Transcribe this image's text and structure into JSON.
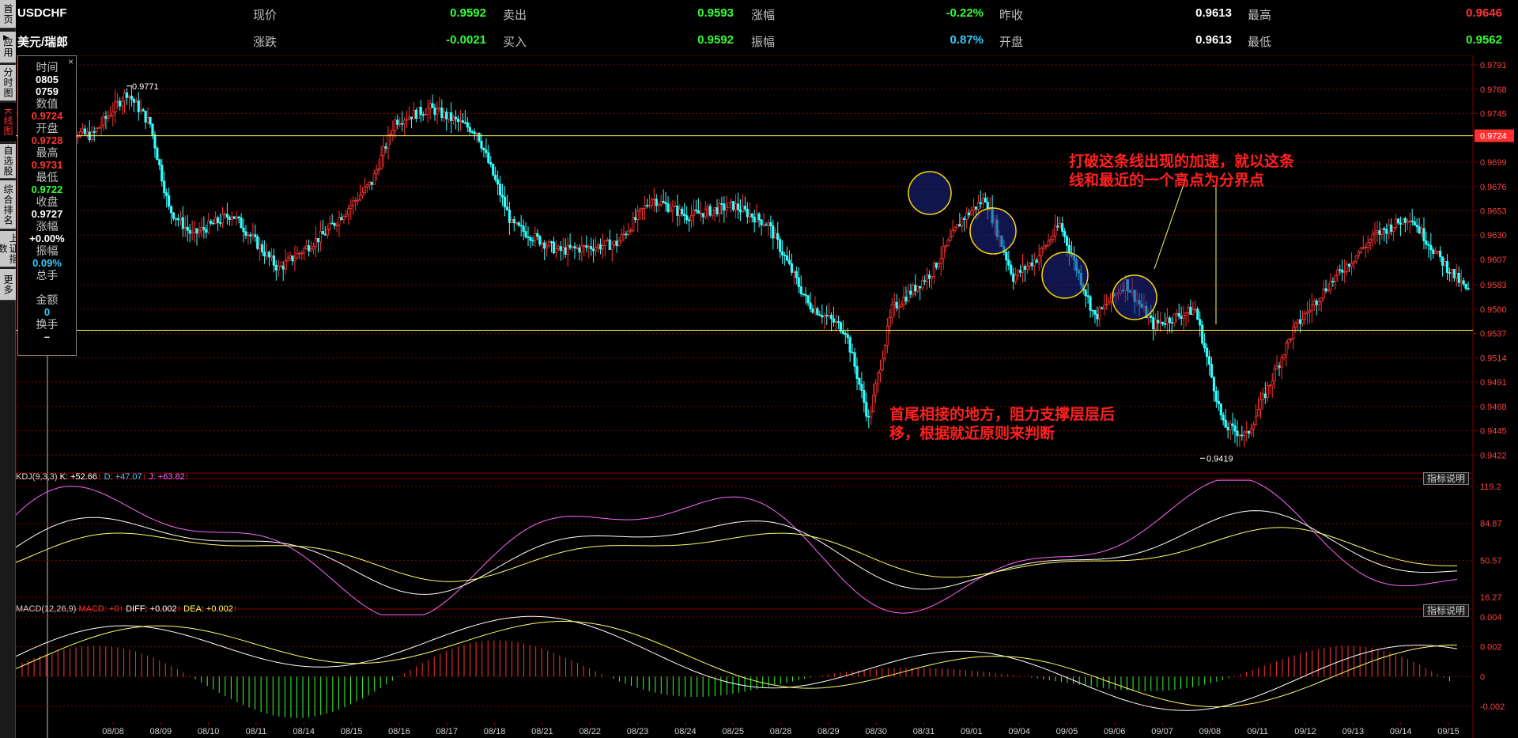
{
  "sidebar": {
    "tabs": [
      {
        "label": "首页"
      },
      {
        "label": "应用"
      },
      {
        "label": "分时图"
      },
      {
        "label": "K线图"
      },
      {
        "label": "自选股"
      },
      {
        "label": "综合排名"
      },
      {
        "label": "上证指数"
      },
      {
        "label": "更多"
      }
    ],
    "play_icon": "▶"
  },
  "header": {
    "symbol": "USDCHF",
    "name": "美元/瑞郎",
    "row1": [
      {
        "label": "现价",
        "value": "0.9592",
        "color": "#33ff33"
      },
      {
        "label": "卖出",
        "value": "0.9593",
        "color": "#33ff33"
      },
      {
        "label": "涨幅",
        "value": "-0.22%",
        "color": "#33ff33"
      },
      {
        "label": "昨收",
        "value": "0.9613",
        "color": "#ffffff"
      },
      {
        "label": "最高",
        "value": "0.9646",
        "color": "#ff3333"
      }
    ],
    "row2": [
      {
        "label": "涨跌",
        "value": "-0.0021",
        "color": "#33ff33"
      },
      {
        "label": "买入",
        "value": "0.9592",
        "color": "#33ff33"
      },
      {
        "label": "振幅",
        "value": "0.87%",
        "color": "#33ccff"
      },
      {
        "label": "开盘",
        "value": "0.9613",
        "color": "#ffffff"
      },
      {
        "label": "最低",
        "value": "0.9562",
        "color": "#33ff33"
      }
    ]
  },
  "info": {
    "close": "×",
    "items": [
      {
        "label": "时间",
        "values": [
          "0805",
          "0759"
        ],
        "color": "#ffffff"
      },
      {
        "label": "数值",
        "values": [
          "0.9724"
        ],
        "color": "#ff3333"
      },
      {
        "label": "开盘",
        "values": [
          "0.9728"
        ],
        "color": "#ff3333"
      },
      {
        "label": "最高",
        "values": [
          "0.9731"
        ],
        "color": "#ff3333"
      },
      {
        "label": "最低",
        "values": [
          "0.9722"
        ],
        "color": "#33ff33"
      },
      {
        "label": "收盘",
        "values": [
          "0.9727"
        ],
        "color": "#ffffff"
      },
      {
        "label": "涨幅",
        "values": [
          "+0.00%"
        ],
        "color": "#ffffff"
      },
      {
        "label": "振幅",
        "values": [
          "0.09%"
        ],
        "color": "#33ccff"
      },
      {
        "label": "总手",
        "values": [
          ""
        ],
        "color": "#ffffff"
      },
      {
        "label": "金额",
        "values": [
          "0"
        ],
        "color": "#33ccff"
      },
      {
        "label": "换手",
        "values": [
          "–"
        ],
        "color": "#ffffff"
      }
    ]
  },
  "annotations": {
    "top": [
      "打破这条线出现的加速，就以这条",
      "线和最近的一个高点为分界点"
    ],
    "bottom": [
      "首尾相接的地方，阻力支撑层层后",
      "移，根据就近原则来判断"
    ]
  },
  "kdj": {
    "title": "KDJ(9,3,3)",
    "k_label": "K: +52.66",
    "d_label": "D: +47.07",
    "j_label": "J: +63.82",
    "arrow": "↑",
    "explain": "指标说明",
    "ticks": [
      "119.2",
      "84.87",
      "50.57",
      "16.27"
    ]
  },
  "macd": {
    "title": "MACD(12,26,9)",
    "macd_label": "MACD: +0",
    "diff_label": "DIFF: +0.002",
    "dea_label": "DEA: +0.002",
    "arrow": "↑",
    "explain": "指标说明",
    "ticks": [
      "0.004",
      "0.002",
      "0",
      "-0.002"
    ]
  },
  "colors": {
    "up": "#ff3333",
    "down": "#33ffff",
    "grid": "#800000",
    "line": "#ffff66",
    "green": "#33ff33"
  },
  "chart_data": {
    "type": "candlestick",
    "yticks": [
      "0.9791",
      "0.9768",
      "0.9745",
      "0.9724",
      "0.9699",
      "0.9676",
      "0.9653",
      "0.9630",
      "0.9607",
      "0.9583",
      "0.9560",
      "0.9537",
      "0.9514",
      "0.9491",
      "0.9468",
      "0.9445",
      "0.9422"
    ],
    "ylim": [
      0.9405,
      0.98
    ],
    "xlabels": [
      "08/08",
      "08/09",
      "08/10",
      "08/11",
      "08/14",
      "08/15",
      "08/16",
      "08/17",
      "08/18",
      "08/21",
      "08/22",
      "08/23",
      "08/24",
      "08/25",
      "08/28",
      "08/29",
      "08/30",
      "08/31",
      "09/01",
      "09/04",
      "09/05",
      "09/06",
      "09/07",
      "09/08",
      "09/11",
      "09/12",
      "09/13",
      "09/14",
      "09/15"
    ],
    "hlines": [
      0.9724,
      0.954
    ],
    "high_mark": {
      "value": 0.9771,
      "label": "0.9771"
    },
    "low_mark": {
      "value": 0.9419,
      "label": "0.9419"
    },
    "current_tag": "0.9724"
  }
}
